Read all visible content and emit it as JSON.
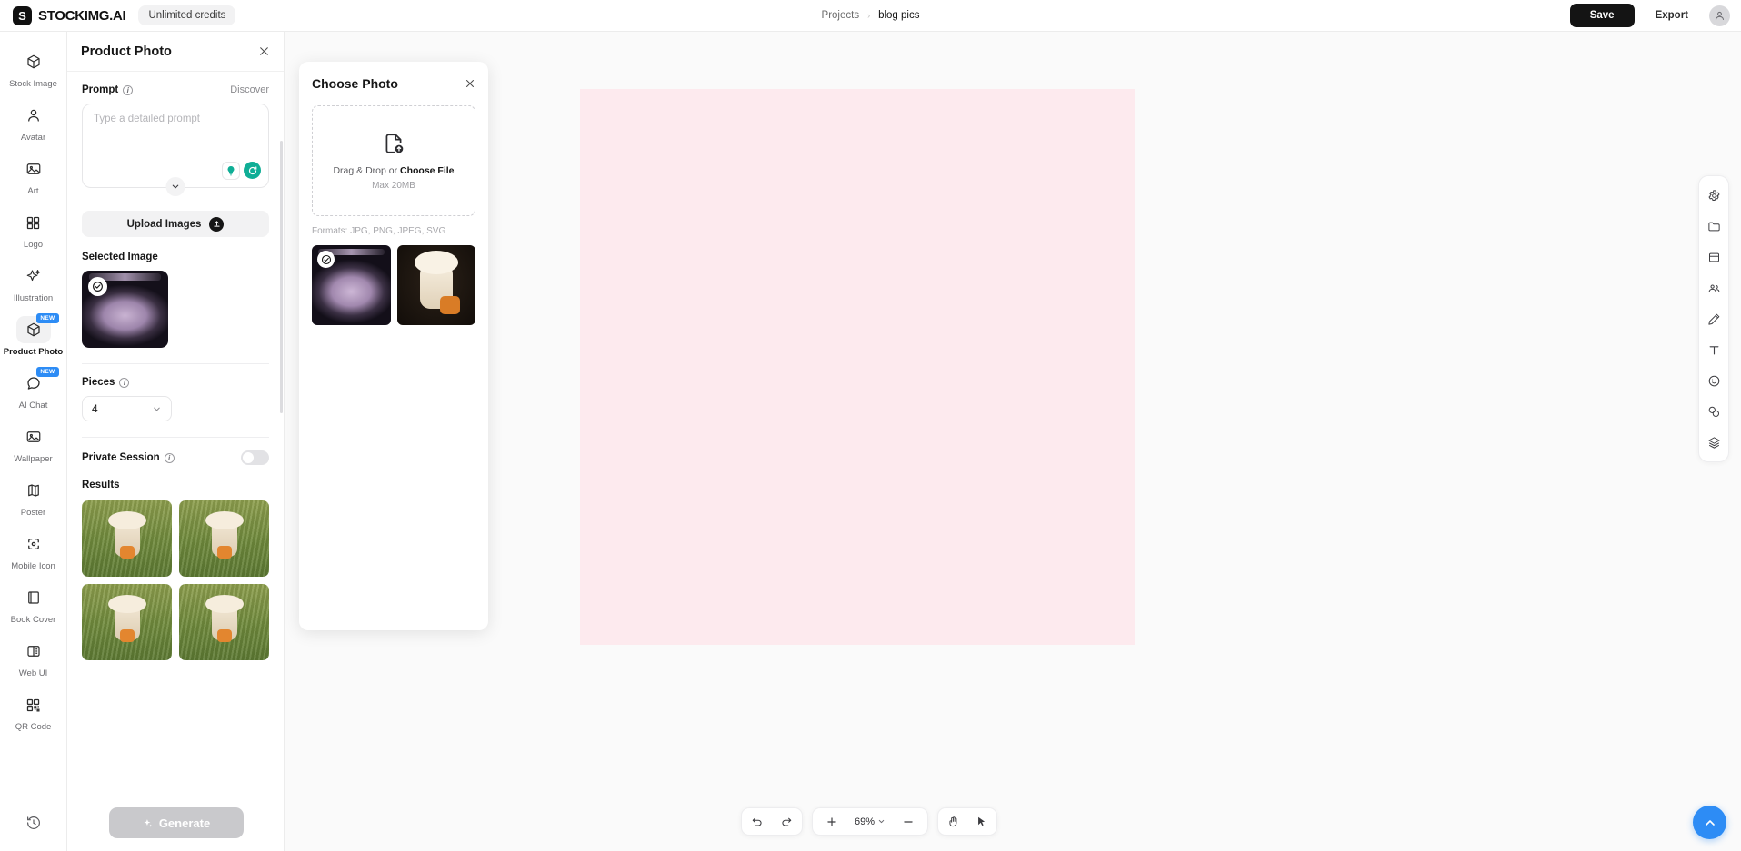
{
  "app": {
    "brand_name": "STOCKIMG.AI",
    "brand_mark": "S",
    "credits": "Unlimited credits"
  },
  "breadcrumb": {
    "projects": "Projects",
    "separator": "›",
    "current": "blog pics"
  },
  "topbar": {
    "save_label": "Save",
    "export_label": "Export",
    "avatar_icon": "user-avatar-icon"
  },
  "sidebar": {
    "items": [
      {
        "label": "Stock Image",
        "icon": "box-icon",
        "active": false,
        "badge": ""
      },
      {
        "label": "Avatar",
        "icon": "person-icon",
        "active": false,
        "badge": ""
      },
      {
        "label": "Art",
        "icon": "image-icon",
        "active": false,
        "badge": ""
      },
      {
        "label": "Logo",
        "icon": "grid-squares-icon",
        "active": false,
        "badge": ""
      },
      {
        "label": "Illustration",
        "icon": "sparkle-icon",
        "active": false,
        "badge": ""
      },
      {
        "label": "Product Photo",
        "icon": "cube-icon",
        "active": true,
        "badge": "NEW"
      },
      {
        "label": "AI Chat",
        "icon": "chat-bubble-icon",
        "active": false,
        "badge": "NEW"
      },
      {
        "label": "Wallpaper",
        "icon": "image-icon",
        "active": false,
        "badge": ""
      },
      {
        "label": "Poster",
        "icon": "map-fold-icon",
        "active": false,
        "badge": ""
      },
      {
        "label": "Mobile Icon",
        "icon": "focus-dot-icon",
        "active": false,
        "badge": ""
      },
      {
        "label": "Book Cover",
        "icon": "book-icon",
        "active": false,
        "badge": ""
      },
      {
        "label": "Web UI",
        "icon": "layout-panel-icon",
        "active": false,
        "badge": ""
      },
      {
        "label": "QR Code",
        "icon": "qr-code-icon",
        "active": false,
        "badge": ""
      }
    ],
    "history_icon": "history-clock-icon"
  },
  "panel": {
    "title": "Product Photo",
    "close_icon": "close-icon",
    "prompt_label": "Prompt",
    "prompt_info_icon": "info-icon",
    "discover_label": "Discover",
    "prompt_value": "",
    "prompt_placeholder": "Type a detailed prompt",
    "prompt_idea_icon": "lightbulb-icon",
    "prompt_regenerate_icon": "refresh-circle-icon",
    "expand_icon": "chevron-down-icon",
    "upload_label": "Upload Images",
    "upload_icon": "upload-icon",
    "selected_image_label": "Selected Image",
    "selected_image_alt": "purple game controller on dark background",
    "selected_check_icon": "check-circle-icon",
    "pieces_label": "Pieces",
    "pieces_info_icon": "info-icon",
    "pieces_value": "4",
    "pieces_chevron_icon": "chevron-down-icon",
    "private_session_label": "Private Session",
    "private_session_info_icon": "info-icon",
    "private_session_on": false,
    "results_label": "Results",
    "results": [
      {
        "alt": "bunny doll in grass with carrots"
      },
      {
        "alt": "bunny doll in grass with carrots"
      },
      {
        "alt": "bunny doll in grass with carrots"
      },
      {
        "alt": "bunny doll in grass with carrots"
      }
    ],
    "generate_label": "Generate",
    "generate_icon": "sparkle-icon"
  },
  "modal": {
    "title": "Choose Photo",
    "close_icon": "close-icon",
    "dropzone_icon": "file-upload-icon",
    "dropzone_text_prefix": "Drag & Drop or ",
    "dropzone_text_link": "Choose File",
    "dropzone_max": "Max 20MB",
    "formats": "Formats: JPG, PNG, JPEG, SVG",
    "thumbnails": [
      {
        "alt": "purple game controller",
        "selected": true,
        "check_icon": "check-circle-icon"
      },
      {
        "alt": "bunny doll with carrots",
        "selected": false,
        "check_icon": ""
      }
    ]
  },
  "canvas": {
    "artboard_color": "#fdeaee",
    "background_color": "#fafafa"
  },
  "right_rail": {
    "items": [
      {
        "icon": "settings-gear-icon"
      },
      {
        "icon": "folder-icon"
      },
      {
        "icon": "frame-icon"
      },
      {
        "icon": "people-icon"
      },
      {
        "icon": "pen-icon"
      },
      {
        "icon": "text-icon"
      },
      {
        "icon": "smiley-icon"
      },
      {
        "icon": "shapes-icon"
      },
      {
        "icon": "layers-icon"
      }
    ]
  },
  "bottom_toolbar": {
    "undo_icon": "undo-icon",
    "redo_icon": "redo-icon",
    "zoom_in_icon": "plus-icon",
    "zoom_out_icon": "minus-icon",
    "zoom_value": "69%",
    "zoom_chevron_icon": "chevron-down-icon",
    "hand_tool_icon": "hand-icon",
    "select_tool_icon": "cursor-arrow-icon",
    "fab_icon": "chevron-up-icon"
  }
}
